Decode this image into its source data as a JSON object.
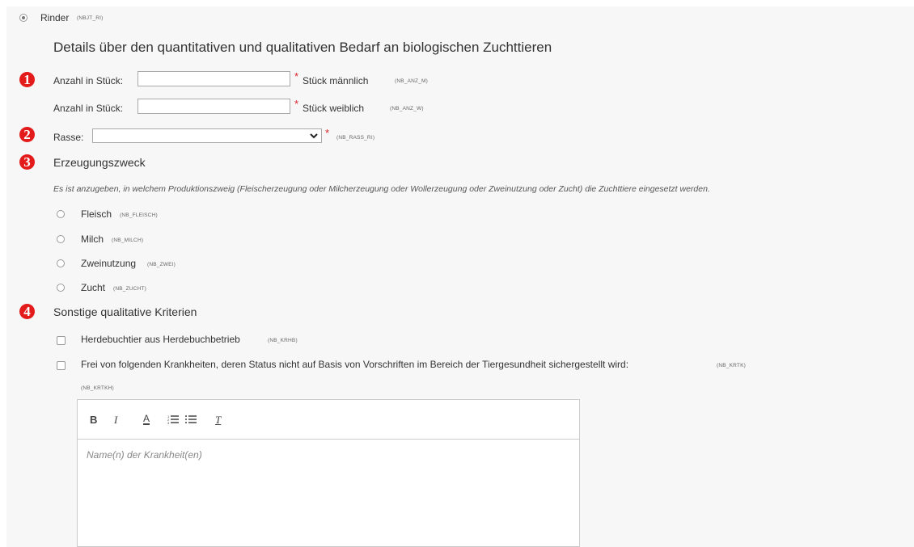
{
  "species": {
    "label": "Rinder",
    "code": "(NBJT_RI)"
  },
  "section_title": "Details über den quantitativen und qualitativen Bedarf an biologischen Zuchttieren",
  "badges": [
    "1",
    "2",
    "3",
    "4"
  ],
  "quantity": {
    "male": {
      "label": "Anzahl in Stück:",
      "value": "",
      "required": "*",
      "unit": "Stück männlich",
      "code": "(NB_ANZ_M)"
    },
    "female": {
      "label": "Anzahl in Stück:",
      "value": "",
      "required": "*",
      "unit": "Stück weiblich",
      "code": "(NB_ANZ_W)"
    }
  },
  "breed": {
    "label": "Rasse:",
    "selected": "",
    "required": "*",
    "code": "(NB_RASS_RI)"
  },
  "purpose": {
    "title": "Erzeugungszweck",
    "hint": "Es ist anzugeben, in welchem Produktionszweig (Fleischerzeugung oder Milcherzeugung oder Wollerzeugung oder Zweinutzung oder Zucht) die Zuchttiere eingesetzt werden.",
    "options": [
      {
        "label": "Fleisch",
        "code": "(NB_FLEISCH)"
      },
      {
        "label": "Milch",
        "code": "(NB_MILCH)"
      },
      {
        "label": "Zweinutzung",
        "code": "(NB_ZWEI)"
      },
      {
        "label": "Zucht",
        "code": "(NB_ZUCHT)"
      }
    ]
  },
  "criteria": {
    "title": "Sonstige qualitative Kriterien",
    "herdbook": {
      "label": "Herdebuchtier aus Herdebuchbetrieb",
      "code": "(NB_KRHB)"
    },
    "disease": {
      "label": "Frei von folgenden Krankheiten, deren Status nicht auf Basis von Vorschriften im Bereich der Tiergesundheit sichergestellt wird:",
      "code": "(NB_KRTK)"
    },
    "editor_code": "(NB_KRTKH)",
    "editor_placeholder": "Name(n) der Krankheit(en)"
  },
  "editor_toolbar": {
    "bold": "B",
    "italic": "I",
    "color": "A",
    "clear": "T"
  }
}
